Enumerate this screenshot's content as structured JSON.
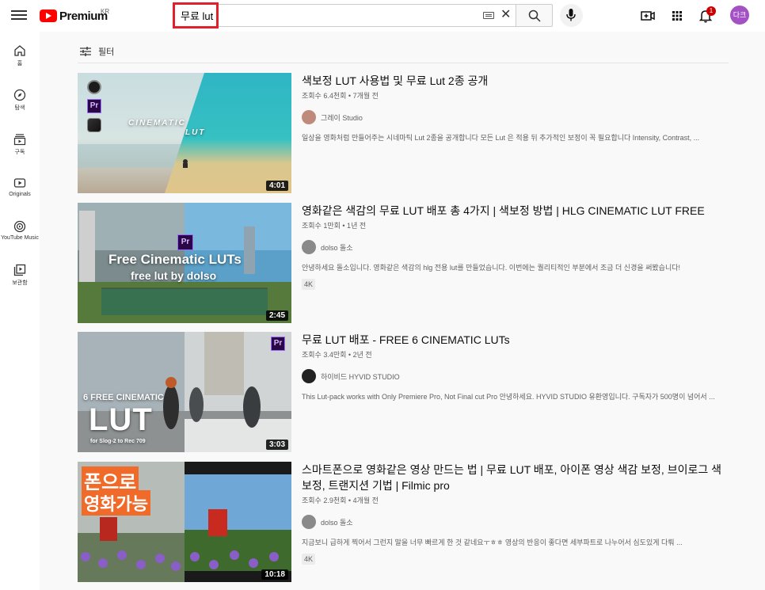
{
  "header": {
    "logo_text": "Premium",
    "country": "KR",
    "search_value": "무료 lut",
    "notification_count": "1",
    "avatar_label": "다크"
  },
  "sidebar": {
    "items": [
      {
        "label": "홈",
        "icon": "home-icon"
      },
      {
        "label": "탐색",
        "icon": "compass-icon"
      },
      {
        "label": "구독",
        "icon": "subscriptions-icon"
      },
      {
        "label": "Originals",
        "icon": "originals-icon"
      },
      {
        "label": "YouTube Music",
        "icon": "music-icon"
      },
      {
        "label": "보관함",
        "icon": "library-icon"
      }
    ]
  },
  "filter": {
    "label": "필터"
  },
  "results": [
    {
      "title": "색보정 LUT 사용법 및 무료 Lut 2종 공개",
      "meta": "조회수 6.4천회 • 7개월 전",
      "channel": "그레이 Studio",
      "description": "일상을 영화처럼 만들어주는 시네마틱 Lut 2종을 공개합니다 모든 Lut 은 적용 뒤 추가적인 보정이 꼭 필요합니다 Intensity, Contrast, ...",
      "duration": "4:01",
      "thumb_text_1": "CINEMATIC",
      "thumb_text_2": "LUT",
      "badge": ""
    },
    {
      "title": "영화같은 색감의 무료 LUT 배포 총 4가지 | 색보정 방법 | HLG CINEMATIC LUT FREE",
      "meta": "조회수 1만회 • 1년 전",
      "channel": "dolso 돌소",
      "description": "안녕하세요 돌소입니다. 영화같은 색감의 hlg 전용 lut를 만들었습니다. 이번에는 퀄리티적인 부분에서 조금 더 신경을 써봤습니다!",
      "duration": "2:45",
      "thumb_text_1": "Free Cinematic LUTs",
      "thumb_text_2": "free lut by dolso",
      "badge": "4K"
    },
    {
      "title": "무료 LUT 배포 - FREE 6 CINEMATIC LUTs",
      "meta": "조회수 3.4만회 • 2년 전",
      "channel": "하이비드 HYVID STUDIO",
      "description": "This Lut-pack works with Only Premiere Pro, Not Final cut Pro 안녕하세요. HYVID STUDIO 유환영입니다. 구독자가 500명이 넘어서 ...",
      "duration": "3:03",
      "thumb_text_1": "6 FREE CINEMATIC",
      "thumb_text_2": "LUT",
      "thumb_text_3": "for Slog-2 to Rec 709",
      "badge": ""
    },
    {
      "title": "스마트폰으로 영화같은 영상 만드는 법 | 무료 LUT 배포, 아이폰 영상 색감 보정, 브이로그 색보정, 트랜지션 기법 | Filmic pro",
      "meta": "조회수 2.9천회 • 4개월 전",
      "channel": "dolso 돌소",
      "description": "지금보니 급하게 찍어서 그런지 말을 너무 빠르게 한 것 같네요ㅜㅎㅎ 영상의 반응이 좋다면 세부파트로 나누어서 심도있게 다뤄 ...",
      "duration": "10:18",
      "thumb_text_1": "폰으로",
      "thumb_text_2": "영화가능",
      "badge": "4K"
    }
  ],
  "colors": {
    "brand": "#ff0000",
    "highlight": "#e0202a",
    "avatar": "#a451c6",
    "badge": "#cc0000"
  }
}
